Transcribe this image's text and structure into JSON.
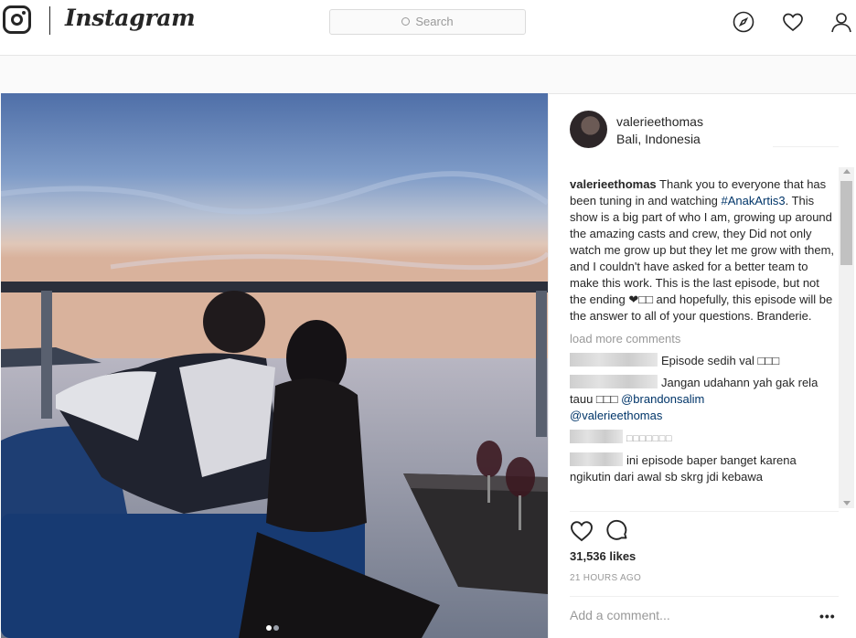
{
  "header": {
    "brand": "Instagram",
    "search_placeholder": "Search",
    "icons": [
      "instagram-glyph-icon",
      "compass-icon",
      "heart-icon",
      "profile-icon"
    ]
  },
  "post": {
    "username": "valerieethomas",
    "location": "Bali, Indonesia",
    "caption": {
      "user": "valerieethomas",
      "text_before_tag": " Thank you to everyone that has been tuning in and watching ",
      "tag": "#AnakArtis3",
      "text_after_tag": ". This show is a big part of who I am, growing up around the amazing casts and crew, they Did not only watch me grow up but they let me grow with them, and I couldn't have asked for a better team to make this work. This is the last episode, but not the ending ❤□□ and hopefully, this episode will be the answer to all of your questions. Branderie."
    },
    "load_more": "load more comments",
    "comments": [
      {
        "text": "Episode sedih val □□□"
      },
      {
        "text": "Jangan udahann yah gak rela tauu □□□",
        "mention1": "@brandonsalim",
        "mention2": "@valerieethomas"
      },
      {
        "text": "□□□□□□□"
      },
      {
        "text": "ini episode baper banget karena ngikutin dari awal sb skrg jdi kebawa"
      }
    ],
    "likes": "31,536 likes",
    "time": "21 HOURS AGO",
    "add_comment_placeholder": "Add a comment...",
    "more_options": "•••",
    "carousel": {
      "count": 2,
      "active": 1
    }
  },
  "colors": {
    "link": "#003569",
    "muted": "#999999",
    "text": "#262626"
  }
}
